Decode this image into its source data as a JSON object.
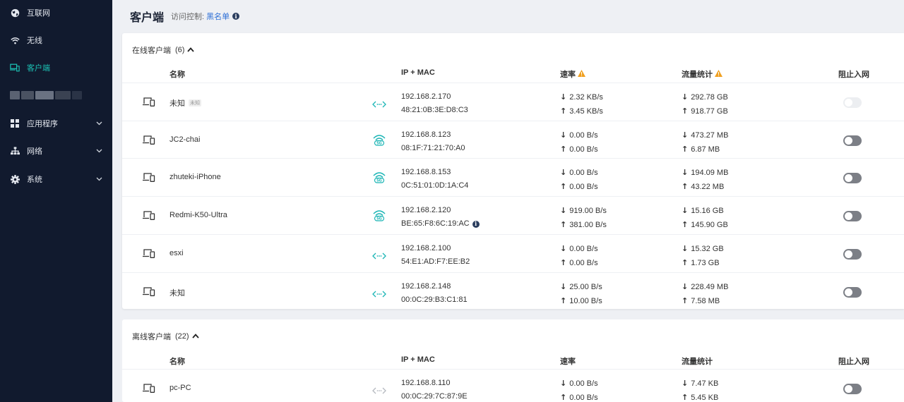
{
  "sidebar": {
    "items": [
      {
        "label": "互联网",
        "icon": "globe-icon"
      },
      {
        "label": "无线",
        "icon": "wifi-icon"
      },
      {
        "label": "客户端",
        "icon": "devices-icon",
        "active": true
      },
      {
        "label": "应用程序",
        "icon": "apps-grid-icon"
      },
      {
        "label": "网络",
        "icon": "network-icon"
      },
      {
        "label": "系统",
        "icon": "gear-icon"
      }
    ],
    "accent_color": "#1cc3b5",
    "bg_color": "#111a2e"
  },
  "header": {
    "title": "客户端",
    "access_label": "访问控制:",
    "access_value": "黑名单"
  },
  "online": {
    "title": "在线客户端",
    "count": "(6)",
    "columns": {
      "name": "名称",
      "ip_mac": "IP + MAC",
      "rate": "速率",
      "traffic": "流量统计",
      "block": "阻止入网"
    },
    "rows": [
      {
        "name": "未知",
        "tag": "未知",
        "ip": "192.168.2.170",
        "mac": "48:21:0B:3E:D8:C3",
        "down_rate": "2.32 KB/s",
        "up_rate": "3.45 KB/s",
        "down_total": "292.78 GB",
        "up_total": "918.77 GB",
        "conn": "wired",
        "toggle_disabled": true
      },
      {
        "name": "JC2-chai",
        "ip": "192.168.8.123",
        "mac": "08:1F:71:21:70:A0",
        "down_rate": "0.00 B/s",
        "up_rate": "0.00 B/s",
        "down_total": "473.27 MB",
        "up_total": "6.87 MB",
        "conn": "wifi-5g"
      },
      {
        "name": "zhuteki-iPhone",
        "ip": "192.168.8.153",
        "mac": "0C:51:01:0D:1A:C4",
        "down_rate": "0.00 B/s",
        "up_rate": "0.00 B/s",
        "down_total": "194.09 MB",
        "up_total": "43.22 MB",
        "conn": "wifi-5g"
      },
      {
        "name": "Redmi-K50-Ultra",
        "ip": "192.168.2.120",
        "mac": "BE:65:F8:6C:19:AC",
        "mac_info": true,
        "down_rate": "919.00 B/s",
        "up_rate": "381.00 B/s",
        "down_total": "15.16 GB",
        "up_total": "145.90 GB",
        "conn": "wifi-5g"
      },
      {
        "name": "esxi",
        "ip": "192.168.2.100",
        "mac": "54:E1:AD:F7:EE:B2",
        "down_rate": "0.00 B/s",
        "up_rate": "0.00 B/s",
        "down_total": "15.32 GB",
        "up_total": "1.73 GB",
        "conn": "wired"
      },
      {
        "name": "未知",
        "ip": "192.168.2.148",
        "mac": "00:0C:29:B3:C1:81",
        "down_rate": "25.00 B/s",
        "up_rate": "10.00 B/s",
        "down_total": "228.49 MB",
        "up_total": "7.58 MB",
        "conn": "wired"
      }
    ]
  },
  "offline": {
    "title": "离线客户端",
    "count": "(22)",
    "columns": {
      "name": "名称",
      "ip_mac": "IP + MAC",
      "rate": "速率",
      "traffic": "流量统计",
      "block": "阻止入网"
    },
    "rows": [
      {
        "name": "pc-PC",
        "ip": "192.168.8.110",
        "mac": "00:0C:29:7C:87:9E",
        "down_rate": "0.00 B/s",
        "up_rate": "0.00 B/s",
        "down_total": "7.47 KB",
        "up_total": "5.45 KB",
        "conn": "wired-offline"
      }
    ]
  },
  "arrows": {
    "down": "↓",
    "up": "↑"
  },
  "colors": {
    "teal": "#1bb5b5",
    "warning": "#f0a020",
    "link": "#2d6fd6"
  }
}
